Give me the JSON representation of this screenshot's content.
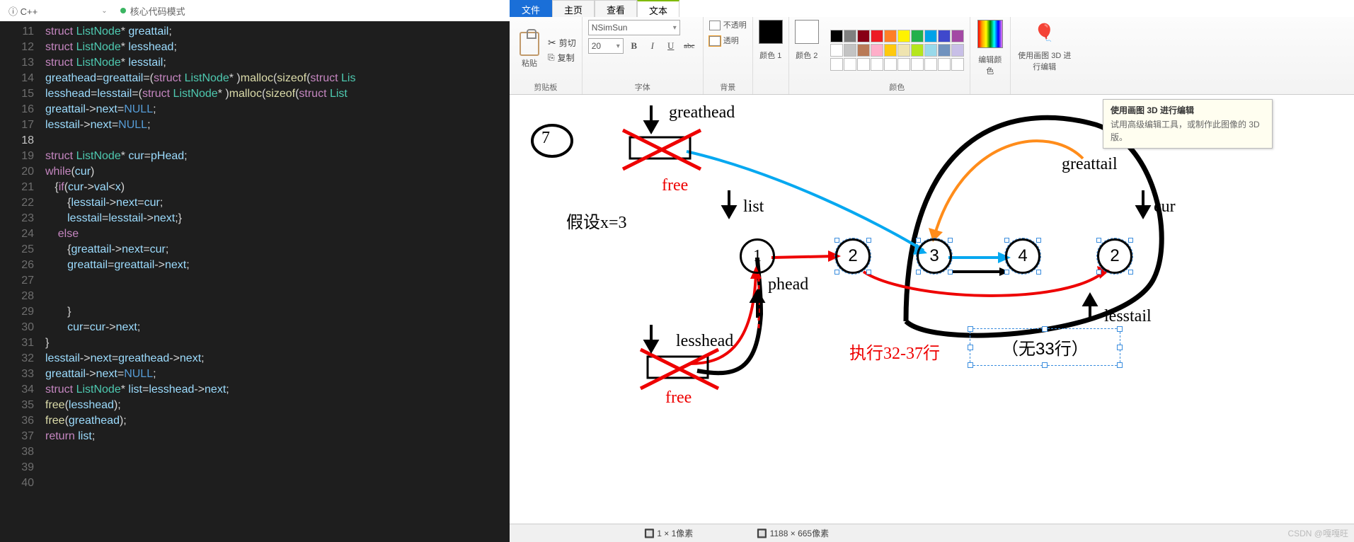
{
  "left_header": {
    "language": "C++",
    "info_icon": "ⓘ",
    "mode": "核心代码模式"
  },
  "code_lines": [
    {
      "n": 11,
      "html": "<span class='kw'>struct</span> <span class='ty'>ListNode</span>* <span class='id'>greattail</span>;"
    },
    {
      "n": 12,
      "html": "<span class='kw'>struct</span> <span class='ty'>ListNode</span>* <span class='id'>lesshead</span>;"
    },
    {
      "n": 13,
      "html": "<span class='kw'>struct</span> <span class='ty'>ListNode</span>* <span class='id'>lesstail</span>;"
    },
    {
      "n": 14,
      "html": "<span class='id'>greathead</span>=<span class='id'>greattail</span>=(<span class='kw'>struct</span> <span class='ty'>ListNode</span>* )<span class='fn'>malloc</span>(<span class='fn'>sizeof</span>(<span class='kw'>struct</span> <span class='ty'>Lis</span>"
    },
    {
      "n": 15,
      "html": "<span class='id'>lesshead</span>=<span class='id'>lesstail</span>=(<span class='kw'>struct</span> <span class='ty'>ListNode</span>* )<span class='fn'>malloc</span>(<span class='fn'>sizeof</span>(<span class='kw'>struct</span> <span class='ty'>List</span>"
    },
    {
      "n": 16,
      "html": "<span class='id'>greattail</span>-&gt;<span class='id'>next</span>=<span class='nl'>NULL</span>;"
    },
    {
      "n": 17,
      "html": "<span class='id'>lesstail</span>-&gt;<span class='id'>next</span>=<span class='nl'>NULL</span>;"
    },
    {
      "n": 18,
      "html": "",
      "cur": true
    },
    {
      "n": 19,
      "html": "<span class='kw'>struct</span> <span class='ty'>ListNode</span>* <span class='id'>cur</span>=<span class='id'>pHead</span>;"
    },
    {
      "n": 20,
      "html": "<span class='kw'>while</span>(<span class='id'>cur</span>)"
    },
    {
      "n": 21,
      "html": "   {<span class='kw'>if</span>(<span class='id'>cur</span>-&gt;<span class='id'>val</span>&lt;<span class='id'>x</span>)"
    },
    {
      "n": 22,
      "html": "       {<span class='id'>lesstail</span>-&gt;<span class='id'>next</span>=<span class='id'>cur</span>;"
    },
    {
      "n": 23,
      "html": "       <span class='id'>lesstail</span>=<span class='id'>lesstail</span>-&gt;<span class='id'>next</span>;}"
    },
    {
      "n": 24,
      "html": "    <span class='kw'>else</span>"
    },
    {
      "n": 25,
      "html": "       {<span class='id'>greattail</span>-&gt;<span class='id'>next</span>=<span class='id'>cur</span>;"
    },
    {
      "n": 26,
      "html": "       <span class='id'>greattail</span>=<span class='id'>greattail</span>-&gt;<span class='id'>next</span>;"
    },
    {
      "n": 27,
      "html": ""
    },
    {
      "n": 28,
      "html": ""
    },
    {
      "n": 29,
      "html": "       }"
    },
    {
      "n": 30,
      "html": "       <span class='id'>cur</span>=<span class='id'>cur</span>-&gt;<span class='id'>next</span>;"
    },
    {
      "n": 31,
      "html": "}"
    },
    {
      "n": 32,
      "html": "<span class='id'>lesstail</span>-&gt;<span class='id'>next</span>=<span class='id'>greathead</span>-&gt;<span class='id'>next</span>;"
    },
    {
      "n": 33,
      "html": "<span class='id'>greattail</span>-&gt;<span class='id'>next</span>=<span class='nl'>NULL</span>;"
    },
    {
      "n": 34,
      "html": "<span class='kw'>struct</span> <span class='ty'>ListNode</span>* <span class='id'>list</span>=<span class='id'>lesshead</span>-&gt;<span class='id'>next</span>;"
    },
    {
      "n": 35,
      "html": "<span class='fn'>free</span>(<span class='id'>lesshead</span>);"
    },
    {
      "n": 36,
      "html": "<span class='fn'>free</span>(<span class='id'>greathead</span>);"
    },
    {
      "n": 37,
      "html": "<span class='kw'>return</span> <span class='id'>list</span>;"
    },
    {
      "n": 38,
      "html": ""
    },
    {
      "n": 39,
      "html": ""
    },
    {
      "n": 40,
      "html": ""
    }
  ],
  "paint": {
    "tabs": {
      "file": "文件",
      "home": "主页",
      "view": "查看",
      "text": "文本"
    },
    "ribbon": {
      "paste": "粘贴",
      "cut": "剪切",
      "copy": "复制",
      "clipboard_label": "剪贴板",
      "font_name": "NSimSun",
      "font_size": "20",
      "font_label": "字体",
      "bold": "B",
      "italic": "I",
      "underline": "U",
      "strike": "abc",
      "opaque": "不透明",
      "transparent": "透明",
      "bg_label": "背景",
      "color1": "颜色 1",
      "color2": "颜色 2",
      "colors_label": "颜色",
      "edit_colors": "编辑颜色",
      "paint3d": "使用画图 3D 进行编辑"
    },
    "palette_row1": [
      "#000",
      "#7f7f7f",
      "#880015",
      "#ed1c24",
      "#ff7f27",
      "#fff200",
      "#22b14c",
      "#00a2e8",
      "#3f48cc",
      "#a349a4"
    ],
    "palette_row2": [
      "#fff",
      "#c3c3c3",
      "#b97a57",
      "#ffaec9",
      "#ffc90e",
      "#efe4b0",
      "#b5e61d",
      "#99d9ea",
      "#7092be",
      "#c8bfe7"
    ],
    "palette_row3": [
      "#fff",
      "#fff",
      "#fff",
      "#fff",
      "#fff",
      "#fff",
      "#fff",
      "#fff",
      "#fff",
      "#fff"
    ],
    "canvas": {
      "greathead": "greathead",
      "free": "free",
      "assume": "假设x=3",
      "list": "list",
      "phead": "phead",
      "lesshead": "lesshead",
      "greattail": "greattail",
      "cur": "cur",
      "lesstail": "lesstail",
      "exec": "执行32-37行",
      "textbox": "（无33行）",
      "nodes": [
        "1",
        "2",
        "3",
        "4",
        "2"
      ],
      "seven": "7"
    },
    "tooltip": {
      "title": "使用画图 3D 进行编辑",
      "body": "试用高级编辑工具，或制作此图像的 3D 版。"
    },
    "status": {
      "cursor": "1 × 1像素",
      "size": "1188 × 665像素"
    }
  },
  "watermark": "CSDN @嘎嘎旺"
}
